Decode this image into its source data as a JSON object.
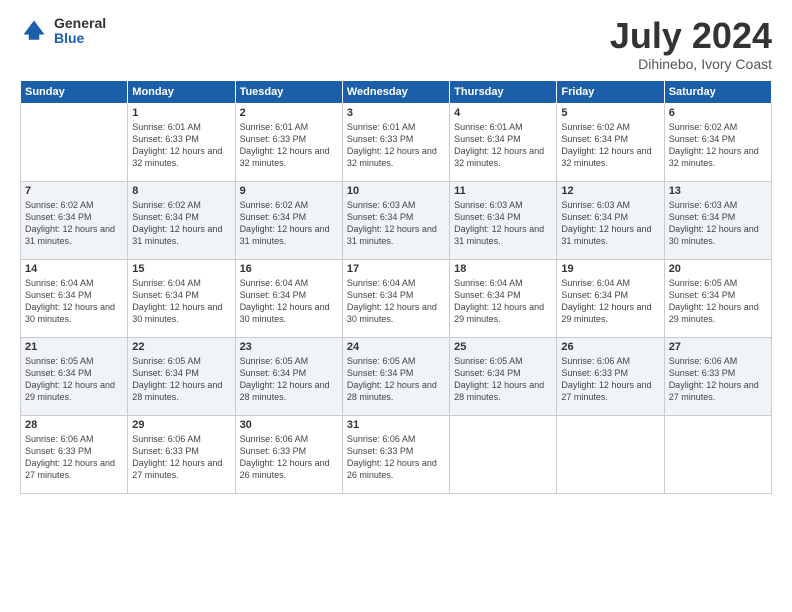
{
  "logo": {
    "general": "General",
    "blue": "Blue"
  },
  "header": {
    "month": "July 2024",
    "location": "Dihinebo, Ivory Coast"
  },
  "weekdays": [
    "Sunday",
    "Monday",
    "Tuesday",
    "Wednesday",
    "Thursday",
    "Friday",
    "Saturday"
  ],
  "weeks": [
    [
      {
        "day": "",
        "sunrise": "",
        "sunset": "",
        "daylight": ""
      },
      {
        "day": "1",
        "sunrise": "Sunrise: 6:01 AM",
        "sunset": "Sunset: 6:33 PM",
        "daylight": "Daylight: 12 hours and 32 minutes."
      },
      {
        "day": "2",
        "sunrise": "Sunrise: 6:01 AM",
        "sunset": "Sunset: 6:33 PM",
        "daylight": "Daylight: 12 hours and 32 minutes."
      },
      {
        "day": "3",
        "sunrise": "Sunrise: 6:01 AM",
        "sunset": "Sunset: 6:33 PM",
        "daylight": "Daylight: 12 hours and 32 minutes."
      },
      {
        "day": "4",
        "sunrise": "Sunrise: 6:01 AM",
        "sunset": "Sunset: 6:34 PM",
        "daylight": "Daylight: 12 hours and 32 minutes."
      },
      {
        "day": "5",
        "sunrise": "Sunrise: 6:02 AM",
        "sunset": "Sunset: 6:34 PM",
        "daylight": "Daylight: 12 hours and 32 minutes."
      },
      {
        "day": "6",
        "sunrise": "Sunrise: 6:02 AM",
        "sunset": "Sunset: 6:34 PM",
        "daylight": "Daylight: 12 hours and 32 minutes."
      }
    ],
    [
      {
        "day": "7",
        "sunrise": "Sunrise: 6:02 AM",
        "sunset": "Sunset: 6:34 PM",
        "daylight": "Daylight: 12 hours and 31 minutes."
      },
      {
        "day": "8",
        "sunrise": "Sunrise: 6:02 AM",
        "sunset": "Sunset: 6:34 PM",
        "daylight": "Daylight: 12 hours and 31 minutes."
      },
      {
        "day": "9",
        "sunrise": "Sunrise: 6:02 AM",
        "sunset": "Sunset: 6:34 PM",
        "daylight": "Daylight: 12 hours and 31 minutes."
      },
      {
        "day": "10",
        "sunrise": "Sunrise: 6:03 AM",
        "sunset": "Sunset: 6:34 PM",
        "daylight": "Daylight: 12 hours and 31 minutes."
      },
      {
        "day": "11",
        "sunrise": "Sunrise: 6:03 AM",
        "sunset": "Sunset: 6:34 PM",
        "daylight": "Daylight: 12 hours and 31 minutes."
      },
      {
        "day": "12",
        "sunrise": "Sunrise: 6:03 AM",
        "sunset": "Sunset: 6:34 PM",
        "daylight": "Daylight: 12 hours and 31 minutes."
      },
      {
        "day": "13",
        "sunrise": "Sunrise: 6:03 AM",
        "sunset": "Sunset: 6:34 PM",
        "daylight": "Daylight: 12 hours and 30 minutes."
      }
    ],
    [
      {
        "day": "14",
        "sunrise": "Sunrise: 6:04 AM",
        "sunset": "Sunset: 6:34 PM",
        "daylight": "Daylight: 12 hours and 30 minutes."
      },
      {
        "day": "15",
        "sunrise": "Sunrise: 6:04 AM",
        "sunset": "Sunset: 6:34 PM",
        "daylight": "Daylight: 12 hours and 30 minutes."
      },
      {
        "day": "16",
        "sunrise": "Sunrise: 6:04 AM",
        "sunset": "Sunset: 6:34 PM",
        "daylight": "Daylight: 12 hours and 30 minutes."
      },
      {
        "day": "17",
        "sunrise": "Sunrise: 6:04 AM",
        "sunset": "Sunset: 6:34 PM",
        "daylight": "Daylight: 12 hours and 30 minutes."
      },
      {
        "day": "18",
        "sunrise": "Sunrise: 6:04 AM",
        "sunset": "Sunset: 6:34 PM",
        "daylight": "Daylight: 12 hours and 29 minutes."
      },
      {
        "day": "19",
        "sunrise": "Sunrise: 6:04 AM",
        "sunset": "Sunset: 6:34 PM",
        "daylight": "Daylight: 12 hours and 29 minutes."
      },
      {
        "day": "20",
        "sunrise": "Sunrise: 6:05 AM",
        "sunset": "Sunset: 6:34 PM",
        "daylight": "Daylight: 12 hours and 29 minutes."
      }
    ],
    [
      {
        "day": "21",
        "sunrise": "Sunrise: 6:05 AM",
        "sunset": "Sunset: 6:34 PM",
        "daylight": "Daylight: 12 hours and 29 minutes."
      },
      {
        "day": "22",
        "sunrise": "Sunrise: 6:05 AM",
        "sunset": "Sunset: 6:34 PM",
        "daylight": "Daylight: 12 hours and 28 minutes."
      },
      {
        "day": "23",
        "sunrise": "Sunrise: 6:05 AM",
        "sunset": "Sunset: 6:34 PM",
        "daylight": "Daylight: 12 hours and 28 minutes."
      },
      {
        "day": "24",
        "sunrise": "Sunrise: 6:05 AM",
        "sunset": "Sunset: 6:34 PM",
        "daylight": "Daylight: 12 hours and 28 minutes."
      },
      {
        "day": "25",
        "sunrise": "Sunrise: 6:05 AM",
        "sunset": "Sunset: 6:34 PM",
        "daylight": "Daylight: 12 hours and 28 minutes."
      },
      {
        "day": "26",
        "sunrise": "Sunrise: 6:06 AM",
        "sunset": "Sunset: 6:33 PM",
        "daylight": "Daylight: 12 hours and 27 minutes."
      },
      {
        "day": "27",
        "sunrise": "Sunrise: 6:06 AM",
        "sunset": "Sunset: 6:33 PM",
        "daylight": "Daylight: 12 hours and 27 minutes."
      }
    ],
    [
      {
        "day": "28",
        "sunrise": "Sunrise: 6:06 AM",
        "sunset": "Sunset: 6:33 PM",
        "daylight": "Daylight: 12 hours and 27 minutes."
      },
      {
        "day": "29",
        "sunrise": "Sunrise: 6:06 AM",
        "sunset": "Sunset: 6:33 PM",
        "daylight": "Daylight: 12 hours and 27 minutes."
      },
      {
        "day": "30",
        "sunrise": "Sunrise: 6:06 AM",
        "sunset": "Sunset: 6:33 PM",
        "daylight": "Daylight: 12 hours and 26 minutes."
      },
      {
        "day": "31",
        "sunrise": "Sunrise: 6:06 AM",
        "sunset": "Sunset: 6:33 PM",
        "daylight": "Daylight: 12 hours and 26 minutes."
      },
      {
        "day": "",
        "sunrise": "",
        "sunset": "",
        "daylight": ""
      },
      {
        "day": "",
        "sunrise": "",
        "sunset": "",
        "daylight": ""
      },
      {
        "day": "",
        "sunrise": "",
        "sunset": "",
        "daylight": ""
      }
    ]
  ]
}
